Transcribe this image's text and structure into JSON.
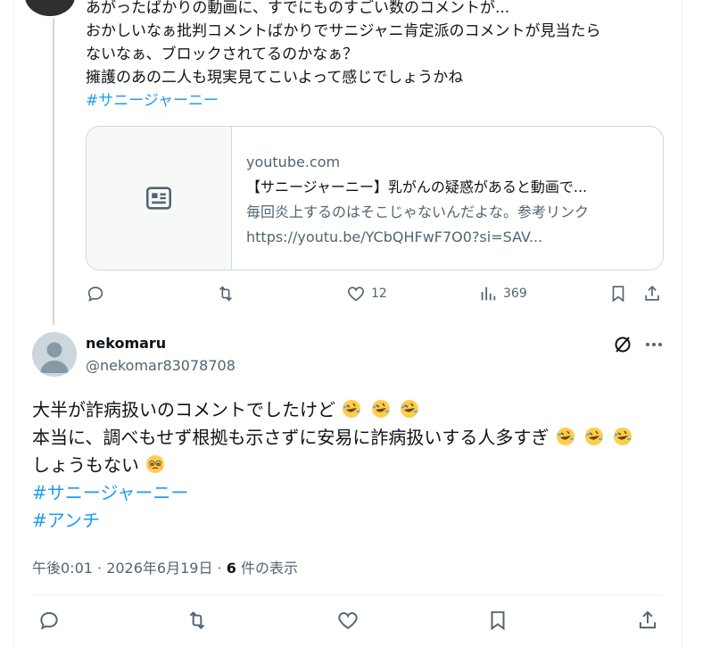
{
  "parent_tweet": {
    "lines": [
      "あがったばかりの動画に、すでにものすごい数のコメントが...",
      "おかしいなぁ批判コメントばかりでサニジャニ肯定派のコメントが見当たら",
      "ないなぁ、ブロックされてるのかなぁ？",
      "擁護のあの二人も現実見てこいよって感じでしょうかね"
    ],
    "hashtag": "#サニージャーニー",
    "link_card": {
      "domain": "youtube.com",
      "title": "【サニージャーニー】乳がんの疑惑があると動画で...",
      "desc": "毎回炎上するのはそこじゃないんだよな。参考リンク",
      "url": "https://youtu.be/YCbQHFwF7O0?si=SAV..."
    },
    "actions": {
      "likes": "12",
      "views": "369"
    }
  },
  "reply": {
    "name": "nekomaru",
    "handle": "@nekomar83078708",
    "line1": "大半が詐病扱いのコメントでしたけど",
    "line2": "本当に、調べもせず根拠も示さずに安易に詐病扱いする人多すぎ",
    "line3": "しょうもない",
    "hashtag1": "#サニージャーニー",
    "hashtag2": "#アンチ",
    "meta_time": "午後0:01 · 2026年6月19日 · ",
    "meta_views_count": "6",
    "meta_views_label": " 件の表示"
  },
  "icons": {
    "reply": "reply-icon",
    "retweet": "retweet-icon",
    "like": "heart-icon",
    "views": "views-icon",
    "bookmark": "bookmark-icon",
    "share": "share-icon",
    "grok": "grok-icon",
    "more": "more-icon",
    "card": "article-icon",
    "emoji_laugh": "rofl-emoji",
    "emoji_pleading": "pleading-emoji"
  },
  "colors": {
    "accent": "#1d9bf0",
    "muted": "#536471",
    "text": "#0f1419",
    "border": "#cfd9de"
  }
}
